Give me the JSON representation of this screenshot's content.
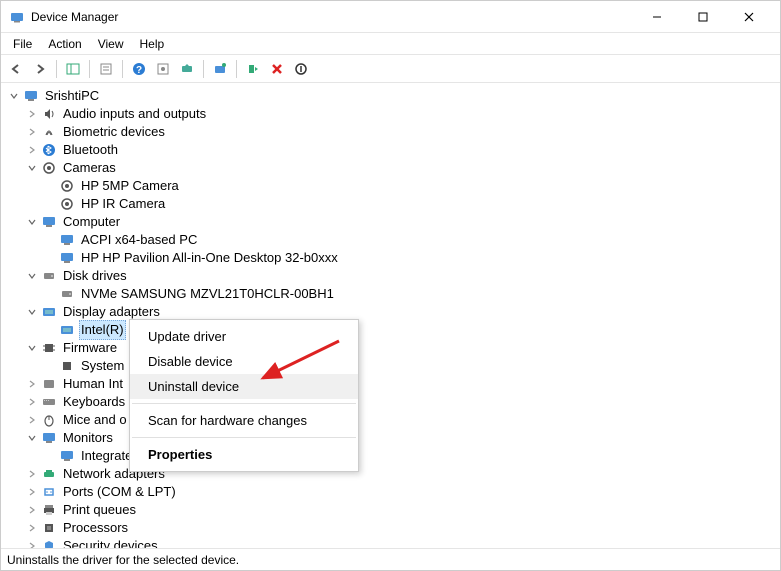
{
  "window": {
    "title": "Device Manager"
  },
  "menubar": {
    "file": "File",
    "action": "Action",
    "view": "View",
    "help": "Help"
  },
  "tree": {
    "root": "SrishtiPC",
    "audio": "Audio inputs and outputs",
    "biometric": "Biometric devices",
    "bluetooth": "Bluetooth",
    "cameras": "Cameras",
    "cam1": "HP 5MP Camera",
    "cam2": "HP IR Camera",
    "computer": "Computer",
    "comp1": "ACPI x64-based PC",
    "comp2": "HP HP Pavilion All-in-One Desktop 32-b0xxx",
    "disk": "Disk drives",
    "disk1": "NVMe SAMSUNG MZVL21T0HCLR-00BH1",
    "display": "Display adapters",
    "display1": "Intel(R)",
    "firmware": "Firmware",
    "fw1": "System",
    "hid": "Human Int",
    "keyboards": "Keyboards",
    "mice": "Mice and o",
    "monitors": "Monitors",
    "mon1": "Integrated Monitor (HP All-In-One)",
    "network": "Network adapters",
    "ports": "Ports (COM & LPT)",
    "printq": "Print queues",
    "processors": "Processors",
    "security": "Security devices"
  },
  "context_menu": {
    "update": "Update driver",
    "disable": "Disable device",
    "uninstall": "Uninstall device",
    "scan": "Scan for hardware changes",
    "properties": "Properties"
  },
  "statusbar": {
    "text": "Uninstalls the driver for the selected device."
  }
}
